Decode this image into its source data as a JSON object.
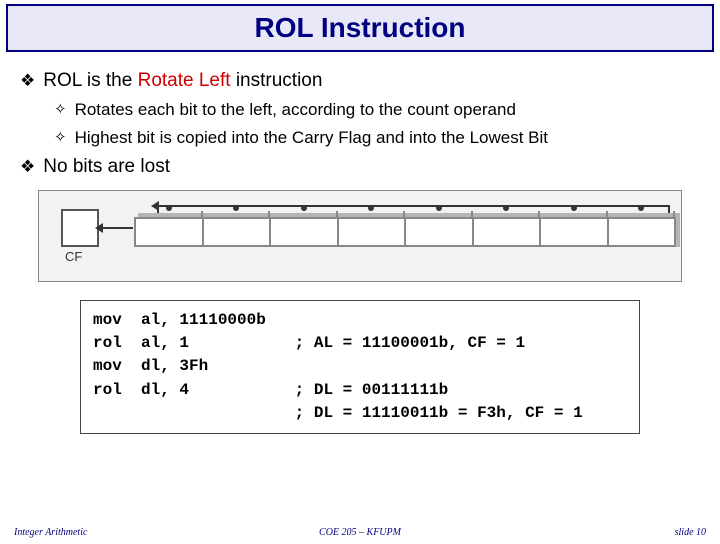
{
  "title": "ROL Instruction",
  "bullets": {
    "b1_pre": "ROL is the ",
    "b1_red": "Rotate Left",
    "b1_post": " instruction",
    "s1": "Rotates each bit to the left, according to the count operand",
    "s2": "Highest bit is copied into the Carry Flag and into the Lowest Bit",
    "b2": "No bits are lost"
  },
  "diagram": {
    "cf_label": "CF"
  },
  "code": "mov  al, 11110000b\nrol  al, 1           ; AL = 11100001b, CF = 1\nmov  dl, 3Fh\nrol  dl, 4           ; DL = 00111111b\n                     ; DL = 11110011b = F3h, CF = 1",
  "code_lines": {
    "l1": "mov  al, 11110000b",
    "l2": "rol  al, 1           ; AL = 11100001b, CF = 1",
    "l3": "mov  dl, 3Fh",
    "l4": "rol  dl, 4           ; DL = 00111111b",
    "l5": "                     ; DL = 11110011b = F3h, CF = 1"
  },
  "footer": {
    "left": "Integer Arithmetic",
    "center": "COE 205 – KFUPM",
    "right": "slide 10"
  }
}
